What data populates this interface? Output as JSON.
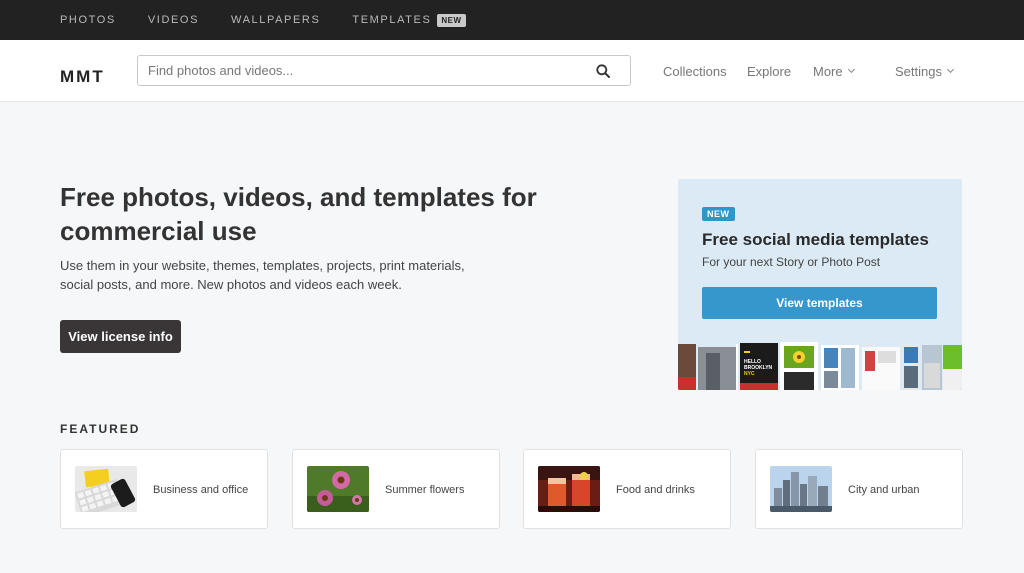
{
  "topnav": {
    "items": [
      "PHOTOS",
      "VIDEOS",
      "WALLPAPERS",
      "TEMPLATES"
    ],
    "templates_badge": "NEW"
  },
  "header": {
    "logo": "MMT",
    "search_placeholder": "Find photos and videos...",
    "nav": {
      "collections": "Collections",
      "explore": "Explore",
      "more": "More",
      "settings": "Settings"
    }
  },
  "hero": {
    "title": "Free photos, videos, and templates for commercial use",
    "text": "Use them in your website, themes, templates, projects, print materials, social posts, and more. New photos and videos each week.",
    "button": "View license info"
  },
  "promo": {
    "badge": "NEW",
    "title": "Free social media templates",
    "subtitle": "For your next Story or Photo Post",
    "button": "View templates",
    "thumb_text": "HELLO BROOKLYN NYC",
    "accent": "#3597cc"
  },
  "featured": {
    "label": "FEATURED",
    "cards": [
      {
        "label": "Business and office",
        "icon": "keyboard-photo"
      },
      {
        "label": "Summer flowers",
        "icon": "flowers-photo"
      },
      {
        "label": "Food and drinks",
        "icon": "drinks-photo"
      },
      {
        "label": "City and urban",
        "icon": "city-photo"
      }
    ]
  }
}
